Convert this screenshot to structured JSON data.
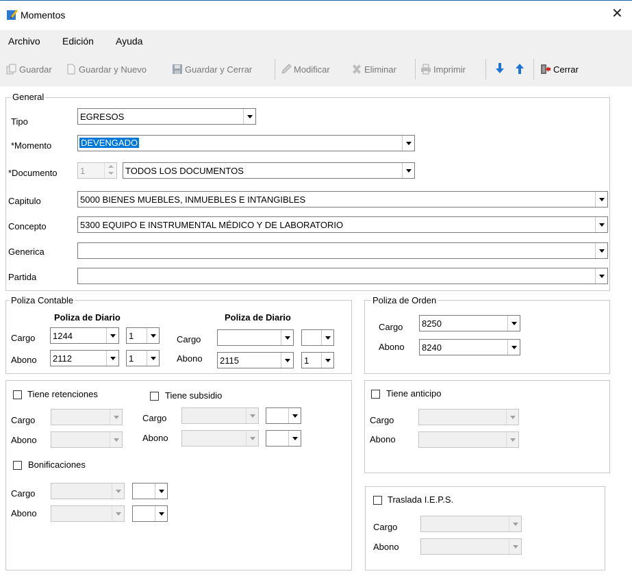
{
  "window": {
    "title": "Momentos"
  },
  "menu": [
    "Archivo",
    "Edición",
    "Ayuda"
  ],
  "toolbar": {
    "guardar": "Guardar",
    "guardar_nuevo": "Guardar y Nuevo",
    "guardar_cerrar": "Guardar y Cerrar",
    "modificar": "Modificar",
    "eliminar": "Eliminar",
    "imprimir": "Imprimir",
    "cerrar": "Cerrar"
  },
  "general": {
    "legend": "General",
    "tipo": {
      "label": "Tipo",
      "value": "EGRESOS"
    },
    "momento": {
      "label": "*Momento",
      "value": "DEVENGADO"
    },
    "documento": {
      "label": "*Documento",
      "number": "1",
      "value": "TODOS LOS DOCUMENTOS"
    },
    "capitulo": {
      "label": "Capitulo",
      "value": "5000 BIENES MUEBLES, INMUEBLES E INTANGIBLES"
    },
    "concepto": {
      "label": "Concepto",
      "value": "5300 EQUIPO E INSTRUMENTAL MÉDICO Y DE LABORATORIO"
    },
    "generica": {
      "label": "Generica",
      "value": ""
    },
    "partida": {
      "label": "Partida",
      "value": ""
    }
  },
  "poliza_contable": {
    "legend": "Poliza Contable",
    "left": {
      "title": "Poliza de Diario",
      "cargo_label": "Cargo",
      "cargo": "1244",
      "cargo_sub": "1",
      "abono_label": "Abono",
      "abono": "2112",
      "abono_sub": "1"
    },
    "right": {
      "title": "Poliza de Diario",
      "cargo_label": "Cargo",
      "cargo": "",
      "cargo_sub": "",
      "abono_label": "Abono",
      "abono": "2115",
      "abono_sub": "1"
    }
  },
  "poliza_orden": {
    "legend": "Poliza de Orden",
    "cargo_label": "Cargo",
    "cargo": "8250",
    "abono_label": "Abono",
    "abono": "8240"
  },
  "retenciones": {
    "tiene_retenciones": "Tiene retenciones",
    "tiene_subsidio": "Tiene subsidio",
    "bonificaciones": "Bonificaciones",
    "cargo_label": "Cargo",
    "abono_label": "Abono"
  },
  "anticipo": {
    "label": "Tiene anticipo",
    "cargo_label": "Cargo",
    "abono_label": "Abono"
  },
  "ieps": {
    "label": "Traslada I.E.P.S.",
    "cargo_label": "Cargo",
    "abono_label": "Abono"
  },
  "colors": {
    "selection": "#0078d7",
    "toolbar_bg": "#f0f0f0",
    "border": "#c9c9c9"
  }
}
